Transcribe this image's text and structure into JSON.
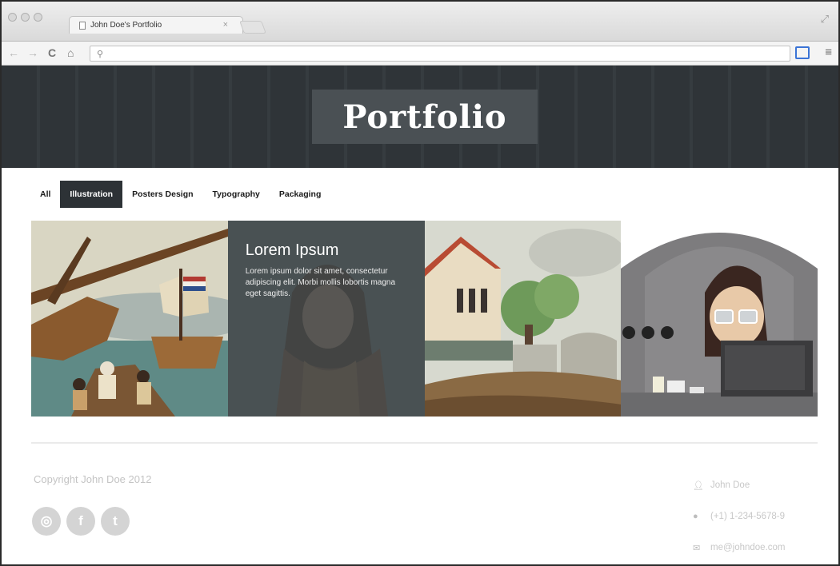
{
  "browser": {
    "tab_title": "John Doe's Portfolio",
    "tab_close": "×",
    "url": "",
    "nav": {
      "back": "←",
      "forward": "→",
      "reload": "C",
      "home": "⌂"
    },
    "menu_icon": "≡",
    "resize_icon": "⤢"
  },
  "header": {
    "logo": "Portfolio"
  },
  "filters": [
    "All",
    "Illustration",
    "Posters Design",
    "Typography",
    "Packaging"
  ],
  "active_filter": "Illustration",
  "gallery": {
    "overlay_title": "Lorem Ipsum",
    "overlay_text": "Lorem ipsum dolor sit amet, consectetur adipiscing elit. Morbi mollis lobortis magna eget sagittis."
  },
  "footer": {
    "copyright": "Copyright John Doe 2012",
    "social": [
      {
        "icon": "dribbble-icon",
        "glyph": "◎"
      },
      {
        "icon": "facebook-icon",
        "glyph": "f"
      },
      {
        "icon": "twitter-icon",
        "glyph": "t"
      }
    ],
    "contact": {
      "name": "John Doe",
      "phone": "(+1) 1-234-5678-9",
      "email": "me@johndoe.com"
    }
  },
  "colors": {
    "header_bg": "#2f3438",
    "active_filter_bg": "#2d3236",
    "logo_box": "#4a5054"
  }
}
